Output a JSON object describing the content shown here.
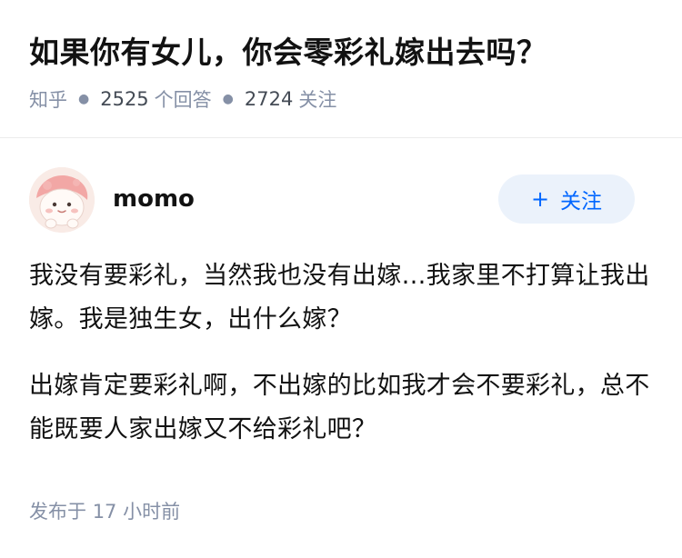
{
  "question": {
    "title": "如果你有女儿，你会零彩礼嫁出去吗？",
    "source": "知乎",
    "answer_count": "2525",
    "answer_label": "个回答",
    "follower_count": "2724",
    "follower_label": "关注"
  },
  "answer": {
    "author": {
      "name": "momo",
      "avatar_icon": "cartoon-avatar-icon"
    },
    "follow_button": {
      "icon": "plus-icon",
      "plus": "+",
      "label": "关注"
    },
    "paragraphs": [
      "我没有要彩礼，当然我也没有出嫁…我家里不打算让我出嫁。我是独生女，出什么嫁？",
      "出嫁肯定要彩礼啊，不出嫁的比如我才会不要彩礼，总不能既要人家出嫁又不给彩礼吧？"
    ],
    "published_label": "发布于",
    "published_time": "17 小时前"
  },
  "colors": {
    "primary_text": "#121212",
    "secondary_text": "#8590a6",
    "accent_blue": "#0066ff",
    "follow_bg": "#ebf2fb"
  }
}
